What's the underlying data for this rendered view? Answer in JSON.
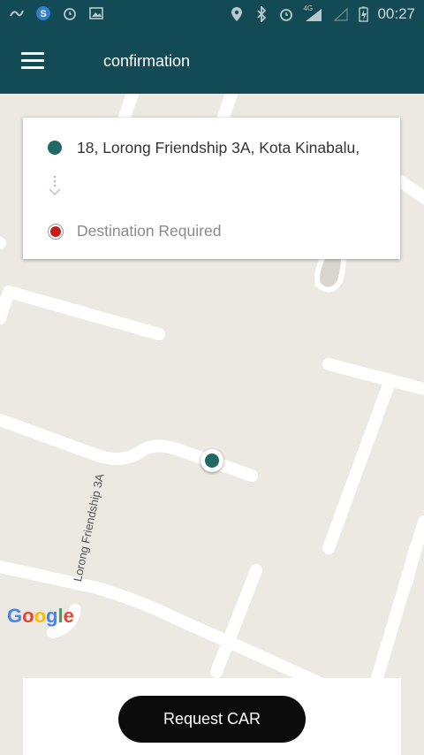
{
  "status_bar": {
    "time": "00:27",
    "network": "4G",
    "left_icons": [
      "link-icon",
      "skype-icon",
      "alarm-icon",
      "image-icon"
    ],
    "right_icons": [
      "location-icon",
      "bluetooth-icon",
      "alarm-icon",
      "signal-icon",
      "battery-icon"
    ]
  },
  "toolbar": {
    "title": "confirmation",
    "menu_icon": "hamburger-menu-icon",
    "background": "#124A55"
  },
  "route_card": {
    "origin": "18, Lorong Friendship 3A, Kota Kinabalu,",
    "destination_placeholder": "Destination Required",
    "origin_color": "#1F6B64",
    "destination_color": "#C41B1B"
  },
  "map": {
    "road_label": "Lorong Friendship 3A",
    "attribution": "Google"
  },
  "actions": {
    "request_label": "Request CAR"
  }
}
